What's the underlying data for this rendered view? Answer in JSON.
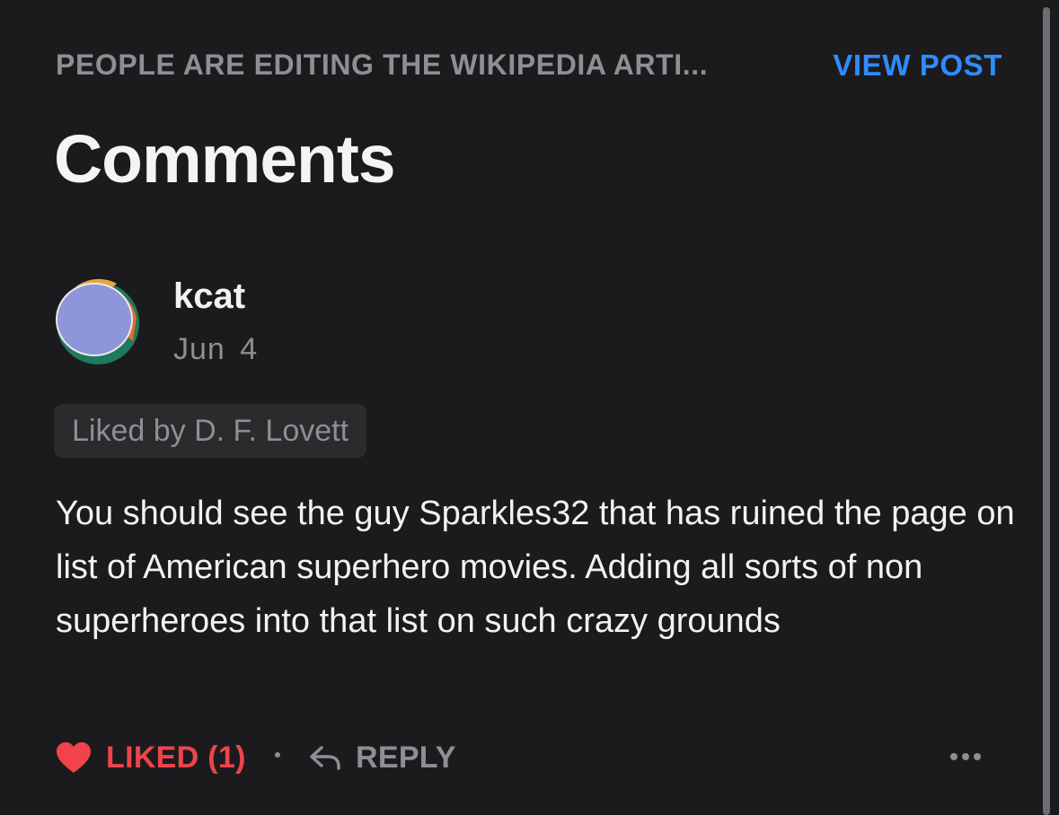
{
  "header": {
    "post_title": "PEOPLE ARE EDITING THE WIKIPEDIA ARTI...",
    "view_post_label": "VIEW POST",
    "page_title": "Comments"
  },
  "comment": {
    "author": "kcat",
    "date": "Jun 4",
    "avatar_icon": "avatar-image",
    "liked_by": "Liked by D. F. Lovett",
    "body": "You should see the guy Sparkles32 that has ruined the page on list of American superhero movies. Adding all sorts of non superheroes into that list on such crazy grounds",
    "actions": {
      "like_icon": "heart-icon",
      "like_label": "LIKED (1)",
      "reply_icon": "reply-arrow-icon",
      "reply_label": "REPLY",
      "more_icon": "more-icon"
    }
  },
  "colors": {
    "background": "#1b1b1d",
    "accent_blue": "#2f8cff",
    "liked_red": "#f0434b",
    "muted_text": "#8e8e93",
    "chip_background": "#2b2b2e"
  }
}
